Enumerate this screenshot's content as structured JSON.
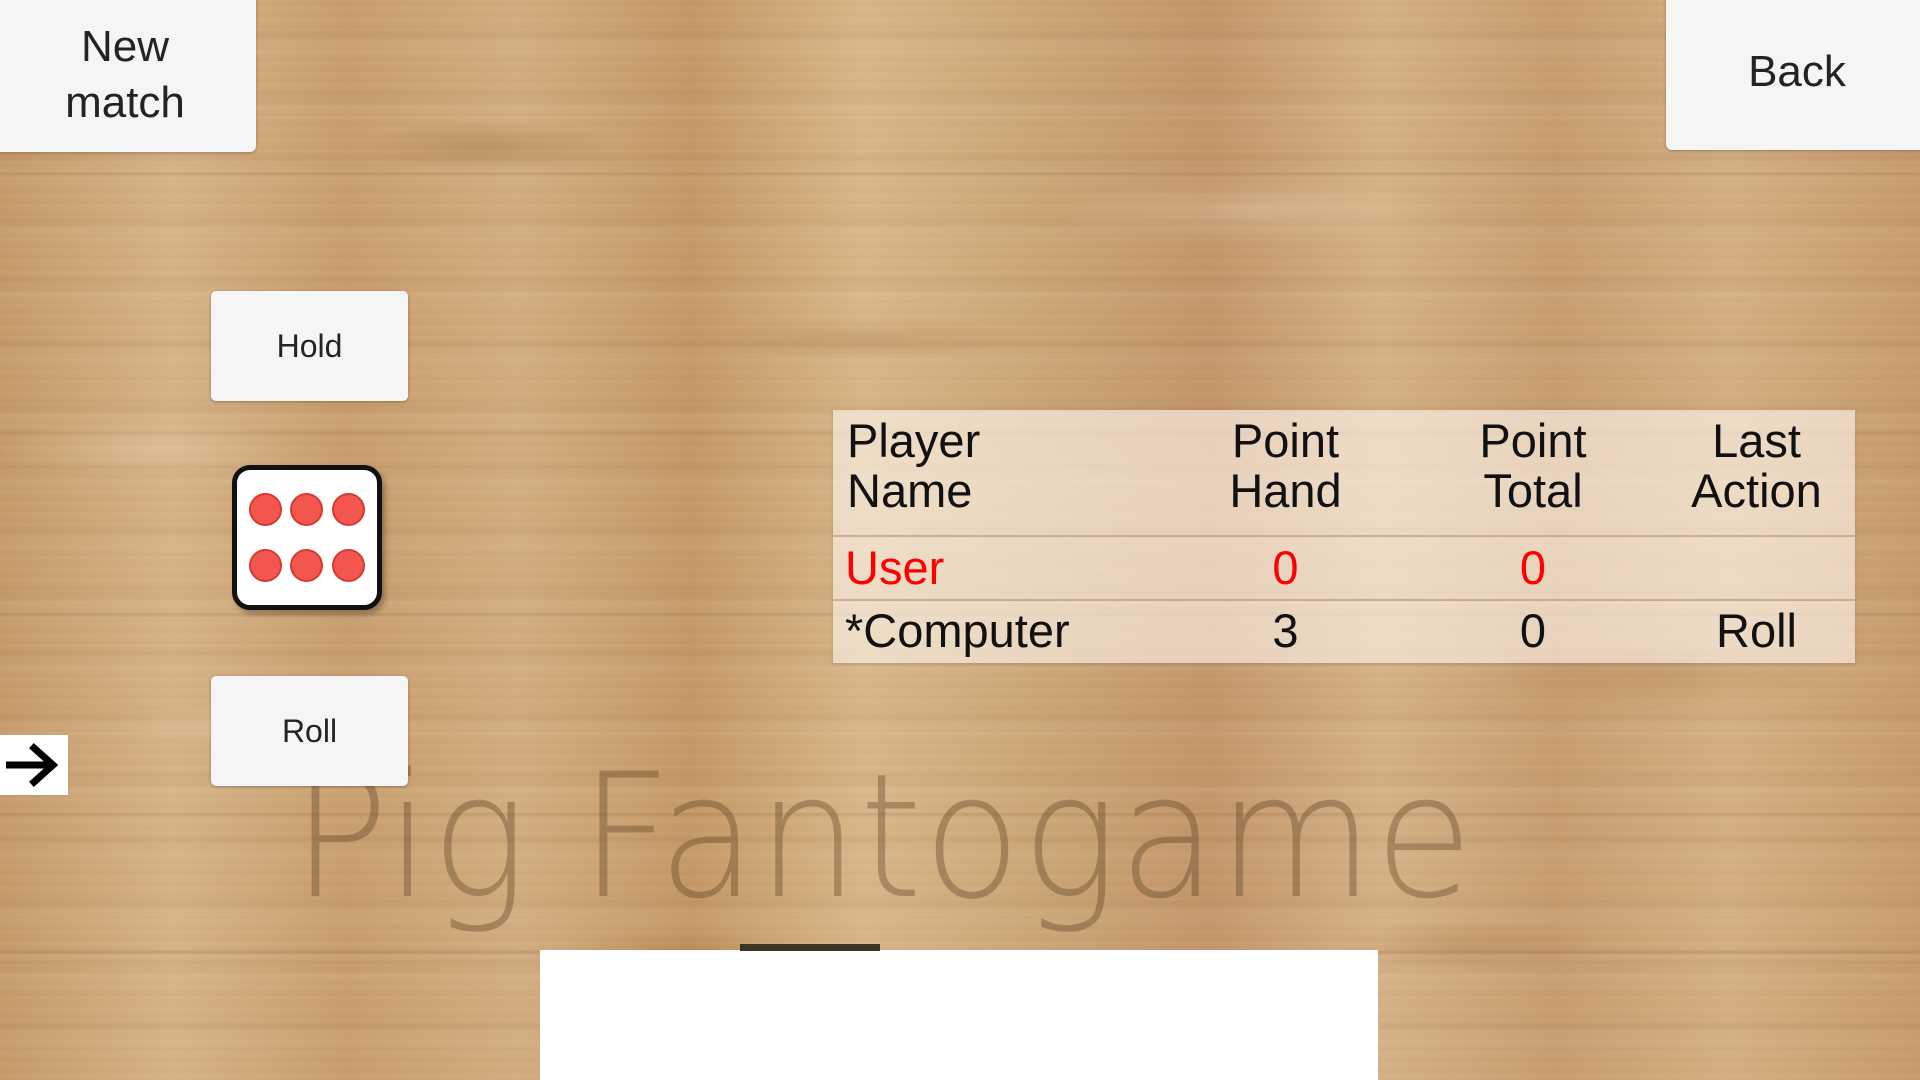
{
  "app": {
    "title": "Pig Fantogame",
    "watermark": "Pig Fantogame"
  },
  "colors": {
    "wood": "#cda77c",
    "button_bg": "#f5f5f5",
    "button_text": "#232323",
    "active_player_text": "#ff0000",
    "inactive_player_text": "#111111",
    "die_face": "#ffffff",
    "die_border": "#111111",
    "die_pip": "#f2564f",
    "panel_bg": "#ffffff",
    "table_bg": "rgba(252,246,236,0.62)"
  },
  "toolbar": {
    "new_match_label": "New\nmatch",
    "back_label": "Back"
  },
  "controls": {
    "hold_label": "Hold",
    "roll_label": "Roll",
    "arrow_icon": "arrow-right-icon"
  },
  "die": {
    "value": 6,
    "pip_count": 6,
    "pips": [
      1,
      2,
      3,
      4,
      5,
      6
    ]
  },
  "scoreboard": {
    "columns": [
      {
        "key": "name",
        "label": "Player\nName"
      },
      {
        "key": "hand",
        "label": "Point\nHand"
      },
      {
        "key": "total",
        "label": "Point\nTotal"
      },
      {
        "key": "action",
        "label": "Last\nAction"
      }
    ],
    "rows": [
      {
        "name": "User",
        "hand": "0",
        "total": "0",
        "action": "",
        "active": true
      },
      {
        "name": "*Computer",
        "hand": "3",
        "total": "0",
        "action": "Roll",
        "active": false
      }
    ]
  }
}
